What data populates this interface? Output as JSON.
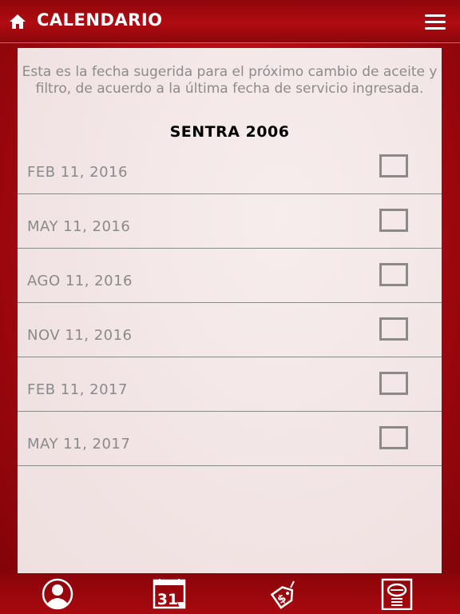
{
  "header": {
    "title": "CALENDARIO",
    "home_icon": "home-icon",
    "menu_icon": "hamburger-menu-icon"
  },
  "content": {
    "intro": "Esta es la fecha sugerida para el próximo cambio de aceite y filtro, de acuerdo a la última fecha de servicio ingresada.",
    "vehicle": "SENTRA 2006",
    "dates": [
      {
        "label": "FEB 11, 2016",
        "checked": false
      },
      {
        "label": "MAY 11, 2016",
        "checked": false
      },
      {
        "label": "AGO 11, 2016",
        "checked": false
      },
      {
        "label": "NOV 11, 2016",
        "checked": false
      },
      {
        "label": "FEB 11, 2017",
        "checked": false
      },
      {
        "label": "MAY 11, 2017",
        "checked": false
      }
    ]
  },
  "tabbar": {
    "tabs": [
      {
        "icon": "user-profile-icon"
      },
      {
        "icon": "calendar-icon",
        "text": "31"
      },
      {
        "icon": "price-tag-icon",
        "text": "$"
      },
      {
        "icon": "service-station-icon"
      }
    ]
  },
  "colors": {
    "brand_red": "#b30a12",
    "card_bg": "#f3e6e6",
    "muted_text": "#8a8a8a"
  }
}
